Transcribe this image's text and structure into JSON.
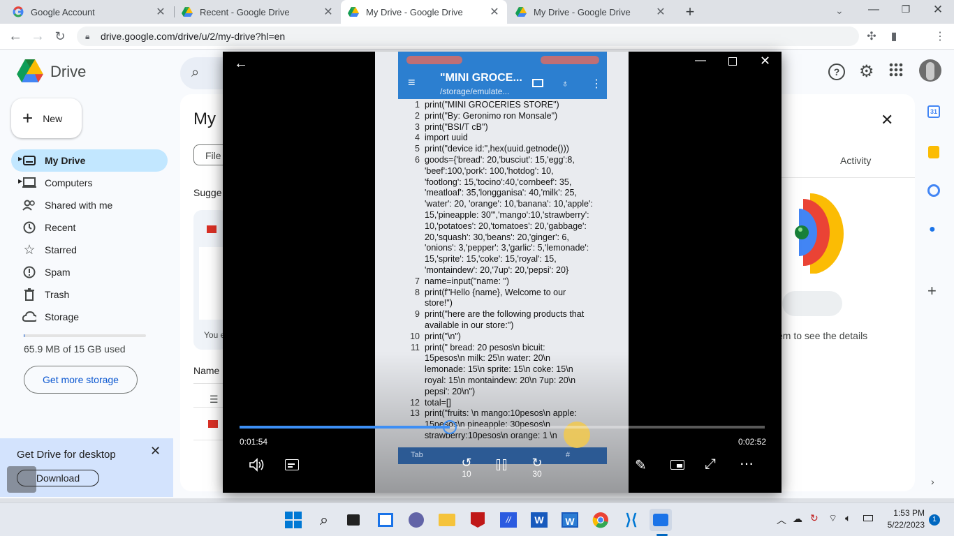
{
  "browser": {
    "tabs": [
      {
        "title": "Google Account"
      },
      {
        "title": "Recent - Google Drive"
      },
      {
        "title": "My Drive - Google Drive"
      },
      {
        "title": "My Drive - Google Drive"
      }
    ],
    "url": "drive.google.com/drive/u/2/my-drive?hl=en"
  },
  "drive": {
    "logo_text": "Drive",
    "new_label": "New",
    "nav": [
      {
        "label": "My Drive",
        "icon": "my-drive-icon"
      },
      {
        "label": "Computers",
        "icon": "computer-icon"
      },
      {
        "label": "Shared with me",
        "icon": "shared-icon"
      },
      {
        "label": "Recent",
        "icon": "clock-icon"
      },
      {
        "label": "Starred",
        "icon": "star-icon"
      },
      {
        "label": "Spam",
        "icon": "spam-icon"
      },
      {
        "label": "Trash",
        "icon": "trash-icon"
      },
      {
        "label": "Storage",
        "icon": "cloud-icon"
      }
    ],
    "storage_used": "65.9 MB of 15 GB used",
    "storage_fraction": 0.0044,
    "get_storage_label": "Get more storage",
    "main_title_fragment": "My",
    "filter_fragment": "File",
    "suggested_fragment": "Sugge",
    "you_fragment": "You e",
    "name_header_fragment": "Name",
    "details_tab": "Activity",
    "details_hint": "em to see the details",
    "desktop_promo": {
      "title": "Get Drive for desktop",
      "button": "Download"
    },
    "accent": "#0b57d0",
    "selected_bg": "#c2e7ff"
  },
  "player": {
    "current_time": "0:01:54",
    "total_time": "0:02:52",
    "progress": 0.4,
    "skip_back": "10",
    "skip_forward": "30",
    "video": {
      "app_title": "\"MINI GROCE...",
      "app_path": "/storage/emulate...",
      "lines": [
        {
          "n": "1",
          "text": "print(\"MINI GROCERIES STORE\")"
        },
        {
          "n": "2",
          "text": "print(\"By: Geronimo ron Monsale\")"
        },
        {
          "n": "3",
          "text": "print(\"BSI/T cB\")"
        },
        {
          "n": "4",
          "text": "import uuid"
        },
        {
          "n": "5",
          "text": "print(\"device id:\",hex(uuid.getnode()))"
        },
        {
          "n": "6",
          "text": "goods={'bread': 20,'busciut': 15,'egg':8,"
        },
        {
          "n": "",
          "text": "'beef':100,'pork': 100,'hotdog': 10,"
        },
        {
          "n": "",
          "text": "'footlong': 15,'tocino':40,'cornbeef': 35,"
        },
        {
          "n": "",
          "text": "'meatloaf': 35,'longganisa': 40,'milk': 25,"
        },
        {
          "n": "",
          "text": "'water': 20, 'orange': 10,'banana': 10,'apple':"
        },
        {
          "n": "",
          "text": "15,'pineapple: 30\"','mango':10,'strawberry':"
        },
        {
          "n": "",
          "text": "10,'potatoes': 20,'tomatoes': 20,'gabbage':"
        },
        {
          "n": "",
          "text": "20,'squash': 30,'beans': 20,'ginger': 6,"
        },
        {
          "n": "",
          "text": "'onions': 3,'pepper': 3,'garlic': 5,'lemonade':"
        },
        {
          "n": "",
          "text": "15,'sprite': 15,'coke': 15,'royal': 15,"
        },
        {
          "n": "",
          "text": "'montaindew': 20,'7up': 20,'pepsi': 20}"
        },
        {
          "n": "7",
          "text": "name=input(\"name: \")"
        },
        {
          "n": "8",
          "text": "print(f\"Hello {name}, Welcome to our"
        },
        {
          "n": "",
          "text": "store!\")"
        },
        {
          "n": "9",
          "text": "print(\"here are the following products that"
        },
        {
          "n": "",
          "text": "available in our store:\")"
        },
        {
          "n": "10",
          "text": "print(\"\\n\")"
        },
        {
          "n": "11",
          "text": "print(\" bread: 20 pesos\\n bicuit:"
        },
        {
          "n": "",
          "text": "15pesos\\n milk: 25\\n water: 20\\n"
        },
        {
          "n": "",
          "text": "lemonade: 15\\n sprite: 15\\n coke: 15\\n"
        },
        {
          "n": "",
          "text": "royal: 15\\n montaindew: 20\\n 7up: 20\\n"
        },
        {
          "n": "",
          "text": "pepsi': 20\\n\")"
        },
        {
          "n": "12",
          "text": "total=[]"
        },
        {
          "n": "13",
          "text": "print(\"fruits: \\n mango:10pesos\\n apple:"
        },
        {
          "n": "",
          "text": "15pesos\\n pineapple: 30pesos\\n"
        },
        {
          "n": "",
          "text": "strawberry:10pesos\\n orange: 1 \\n"
        }
      ],
      "keyboard_tab": "Tab",
      "keyboard_hash": "#"
    }
  },
  "taskbar": {
    "time": "1:53 PM",
    "date": "5/22/2023",
    "notification_count": "1"
  }
}
